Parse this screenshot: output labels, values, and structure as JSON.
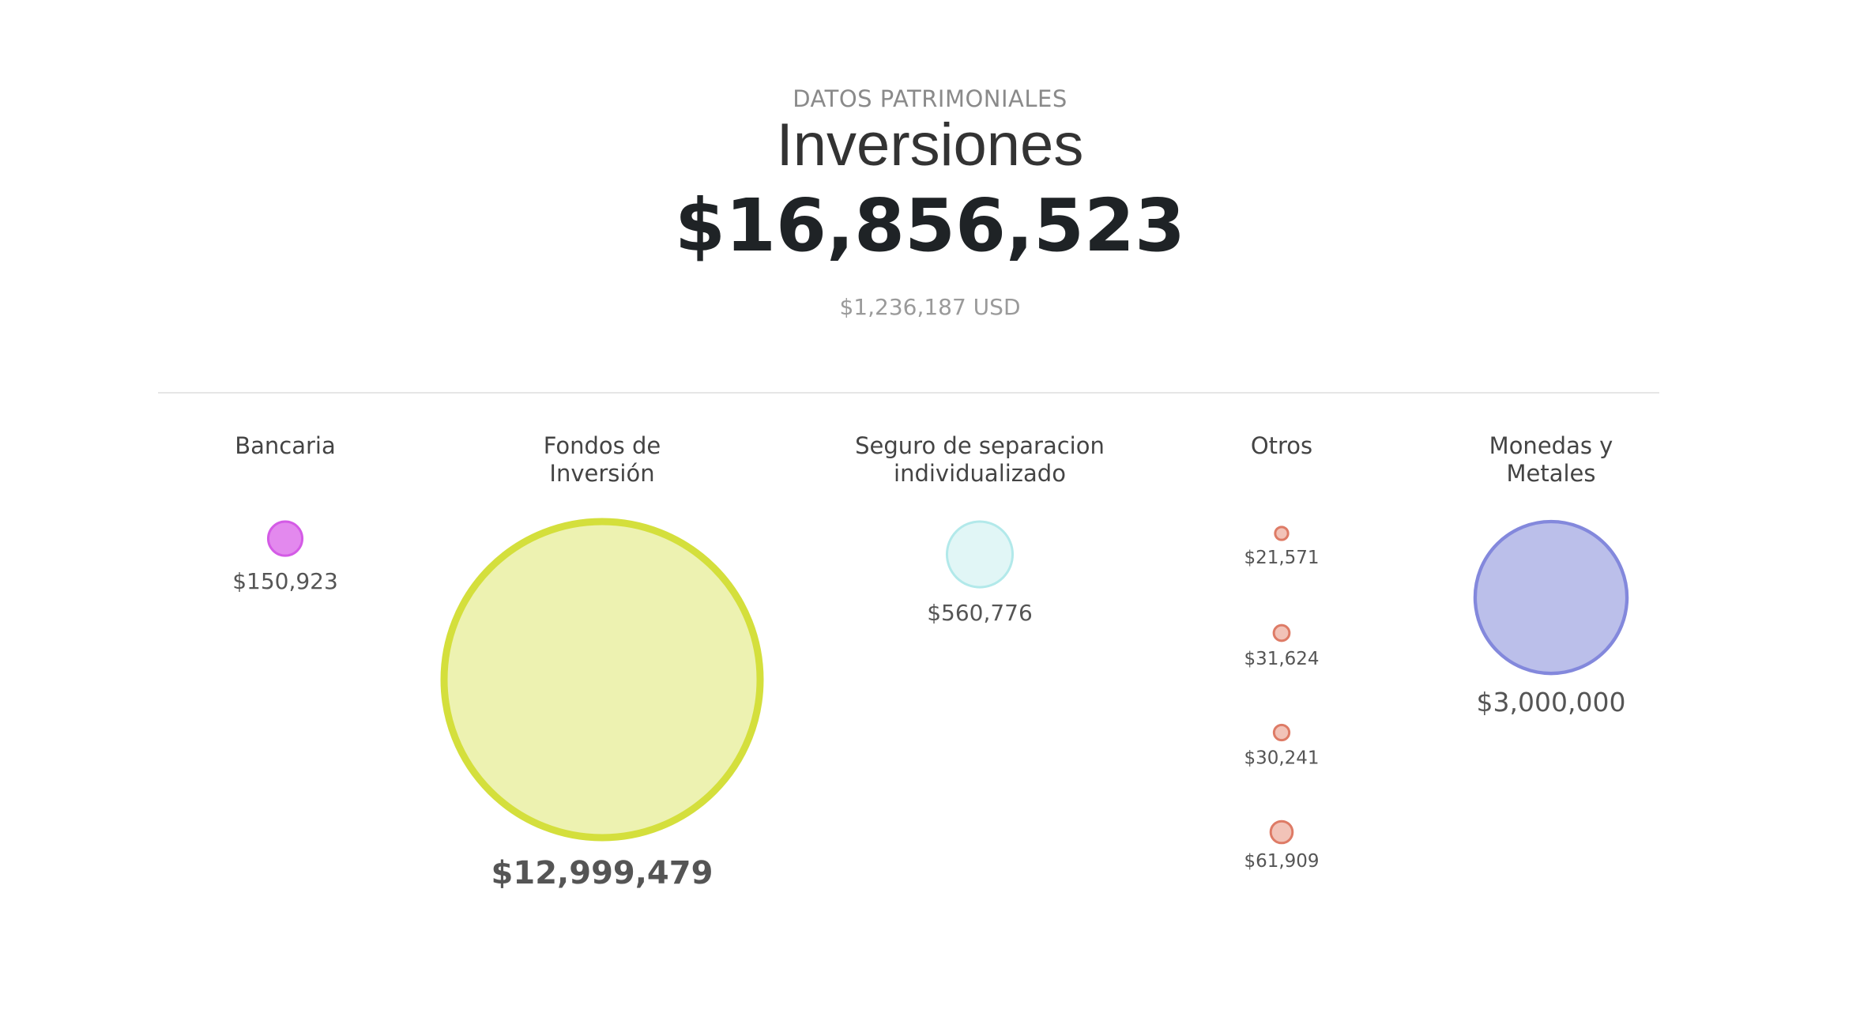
{
  "header": {
    "eyebrow": "DATOS PATRIMONIALES",
    "title": "Inversiones",
    "total": "$16,856,523",
    "usd": "$1,236,187 USD"
  },
  "chart_data": {
    "type": "bubble",
    "categories": [
      {
        "name": "Bancaria",
        "label_lines": [
          "Bancaria"
        ],
        "color": "#e389ee",
        "stroke": "#d45be6",
        "items": [
          {
            "value": 150923,
            "label": "$150,923"
          }
        ]
      },
      {
        "name": "Fondos de Inversión",
        "label_lines": [
          "Fondos de",
          "Inversión"
        ],
        "color": "#edf2b1",
        "stroke": "#d4df3c",
        "items": [
          {
            "value": 12999479,
            "label": "$12,999,479"
          }
        ]
      },
      {
        "name": "Seguro de separacion individualizado",
        "label_lines": [
          "Seguro de separacion",
          "individualizado"
        ],
        "color": "#e1f6f6",
        "stroke": "#b2e9ea",
        "items": [
          {
            "value": 560776,
            "label": "$560,776"
          }
        ]
      },
      {
        "name": "Otros",
        "label_lines": [
          "Otros"
        ],
        "color": "#f2c3b8",
        "stroke": "#de7b66",
        "items": [
          {
            "value": 21571,
            "label": "$21,571"
          },
          {
            "value": 31624,
            "label": "$31,624"
          },
          {
            "value": 30241,
            "label": "$30,241"
          },
          {
            "value": 61909,
            "label": "$61,909"
          }
        ]
      },
      {
        "name": "Monedas y Metales",
        "label_lines": [
          "Monedas y",
          "Metales"
        ],
        "color": "#bbbfea",
        "stroke": "#8388dc",
        "items": [
          {
            "value": 3000000,
            "label": "$3,000,000"
          }
        ]
      }
    ]
  }
}
